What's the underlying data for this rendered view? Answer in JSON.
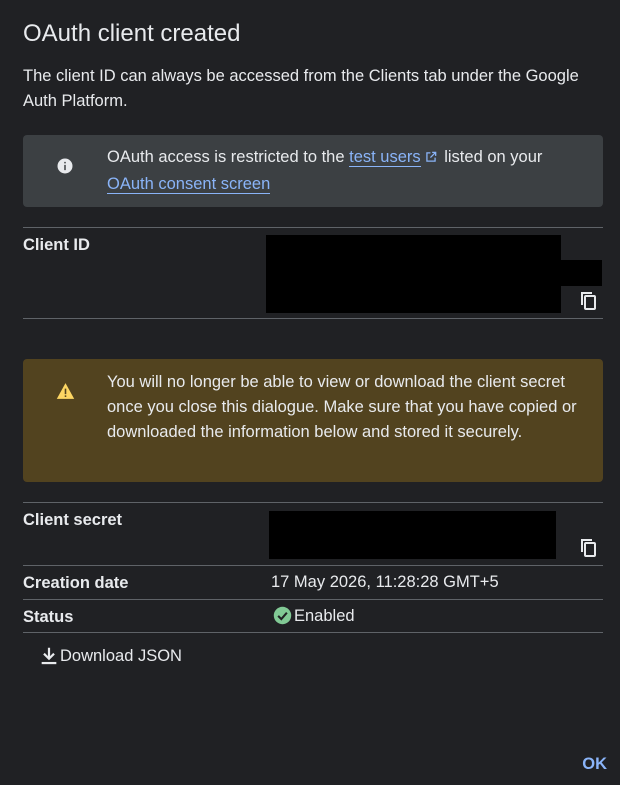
{
  "dialog": {
    "title": "OAuth client created",
    "intro": "The client ID can always be accessed from the Clients tab under the Google Auth Platform."
  },
  "info_notice": {
    "icon": "info-icon",
    "text_before": "OAuth access is restricted to the ",
    "link1": "test users",
    "text_middle": " listed on your ",
    "link2": "OAuth consent screen"
  },
  "client_id": {
    "label": "Client ID",
    "copy_icon": "copy-icon"
  },
  "warning_notice": {
    "icon": "warning-icon",
    "text": "You will no longer be able to view or download the client secret once you close this dialogue. Make sure that you have copied or downloaded the information below and stored it securely."
  },
  "client_secret": {
    "label": "Client secret",
    "copy_icon": "copy-icon"
  },
  "creation_date": {
    "label": "Creation date",
    "value": "17 May 2026, 11:28:28 GMT+5"
  },
  "status": {
    "label": "Status",
    "value": "Enabled",
    "icon": "check-circle-icon"
  },
  "actions": {
    "download_label": "Download JSON",
    "ok_label": "OK"
  },
  "colors": {
    "background": "#202124",
    "link": "#8ab4f8",
    "info_bg": "#3c4043",
    "warning_bg": "#52431f",
    "warning_icon": "#fdd663",
    "status_ok": "#81c995"
  }
}
